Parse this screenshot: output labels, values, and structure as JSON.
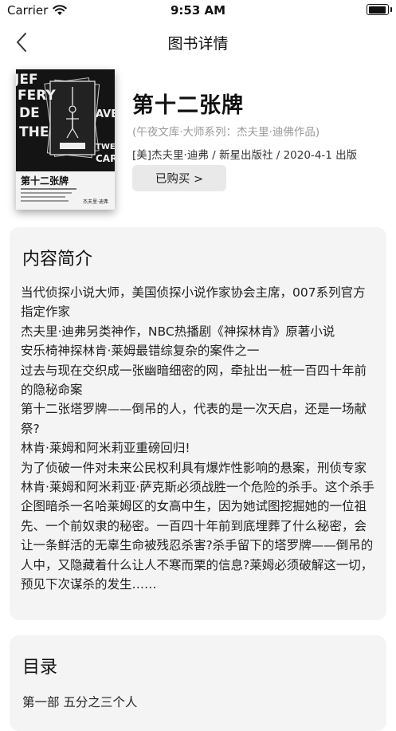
{
  "status_bar": {
    "carrier": "Carrier",
    "time": "9:53 AM",
    "battery_level": 1.0
  },
  "nav": {
    "title": "图书详情"
  },
  "book": {
    "title": "第十二张牌",
    "series": "(午夜文库·大师系列：杰夫里·迪佛作品)",
    "meta": "[美]杰夫里·迪弗 / 新星出版社 / 2020-4-1 出版",
    "bought_label": "已购买 >",
    "cover": {
      "title": "第十二张牌",
      "author": "杰夫里·迪弗",
      "side_letters": [
        "JEF",
        "FERY",
        "DE",
        "AVER",
        "THE",
        "TWELFTH",
        "CARD"
      ],
      "background": "#141414"
    }
  },
  "intro": {
    "heading": "内容简介",
    "text": "当代侦探小说大师，美国侦探小说作家协会主席，007系列官方指定作家\n杰夫里·迪弗另类神作，NBC热播剧《神探林肯》原著小说\n安乐椅神探林肯·莱姆最错综复杂的案件之一\n过去与现在交织成一张幽暗细密的网，牵扯出一桩一百四十年前的隐秘命案\n第十二张塔罗牌——倒吊的人，代表的是一次天启，还是一场献祭?\n林肯·莱姆和阿米莉亚重磅回归!\n为了侦破一件对未来公民权利具有爆炸性影响的悬案，刑侦专家林肯·莱姆和阿米莉亚·萨克斯必须战胜一个危险的杀手。这个杀手企图暗杀一名哈莱姆区的女高中生，因为她试图挖掘她的一位祖先、一个前奴隶的秘密。一百四十年前到底埋葬了什么秘密，会让一条鲜活的无辜生命被残忍杀害?杀手留下的塔罗牌——倒吊的人中，又隐藏着什么让人不寒而栗的信息?莱姆必须破解这一切，预见下次谋杀的发生……"
  },
  "toc": {
    "heading": "目录",
    "first_item": "第一部 五分之三个人"
  }
}
